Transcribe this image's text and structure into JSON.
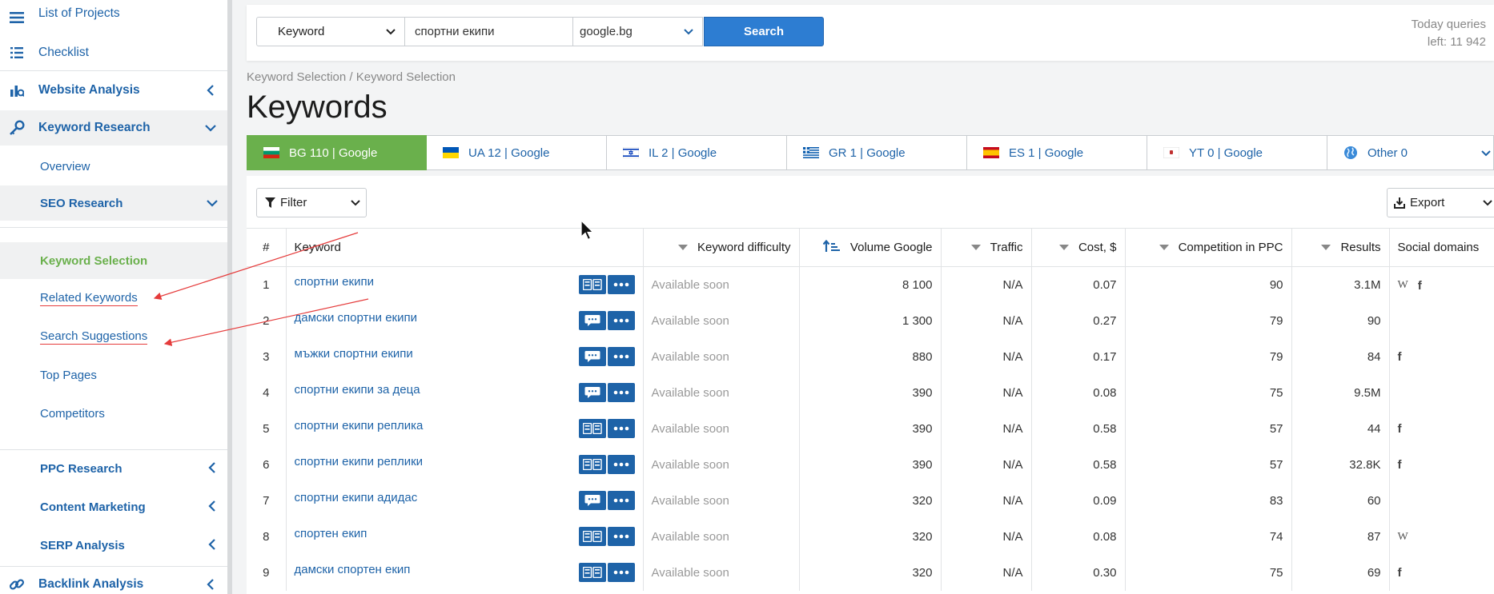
{
  "sidebar": {
    "list_of_projects": "List of Projects",
    "checklist": "Checklist",
    "website_analysis": "Website Analysis",
    "keyword_research": "Keyword Research",
    "overview": "Overview",
    "seo_research": "SEO Research",
    "keyword_selection": "Keyword Selection",
    "related_keywords": "Related Keywords",
    "search_suggestions": "Search Suggestions",
    "top_pages": "Top Pages",
    "competitors": "Competitors",
    "ppc_research": "PPC Research",
    "content_marketing": "Content Marketing",
    "serp_analysis": "SERP Analysis",
    "backlink_analysis": "Backlink Analysis"
  },
  "search": {
    "kind": "Keyword",
    "query": "спортни екипи",
    "engine": "google.bg",
    "button": "Search",
    "queries_line1": "Today queries",
    "queries_line2": "left: 11 942"
  },
  "breadcrumb": "Keyword Selection / Keyword Selection",
  "title": "Keywords",
  "tabs": [
    {
      "label": "BG 110 | Google",
      "flag": "bg"
    },
    {
      "label": "UA 12 | Google",
      "flag": "ua"
    },
    {
      "label": "IL 2 | Google",
      "flag": "il"
    },
    {
      "label": "GR 1 | Google",
      "flag": "gr"
    },
    {
      "label": "ES 1 | Google",
      "flag": "es"
    },
    {
      "label": "YT 0 | Google",
      "flag": "yt"
    },
    {
      "label": "Other 0",
      "flag": "globe"
    }
  ],
  "toolbar": {
    "filter": "Filter",
    "export": "Export"
  },
  "table": {
    "headers": {
      "num": "#",
      "keyword": "Keyword",
      "difficulty": "Keyword difficulty",
      "volume": "Volume Google",
      "traffic": "Traffic",
      "cost": "Cost, $",
      "competition": "Competition in PPC",
      "results": "Results",
      "social": "Social domains"
    },
    "rows": [
      {
        "n": "1",
        "kw": "спортни екипи",
        "icon": "serp",
        "diff": "Available soon",
        "vol": "8 100",
        "traffic": "N/A",
        "cost": "0.07",
        "comp": "90",
        "results": "3.1M",
        "social": [
          "W",
          "f"
        ]
      },
      {
        "n": "2",
        "kw": "дамски спортни екипи",
        "icon": "chat",
        "diff": "Available soon",
        "vol": "1 300",
        "traffic": "N/A",
        "cost": "0.27",
        "comp": "79",
        "results": "90",
        "social": []
      },
      {
        "n": "3",
        "kw": "мъжки спортни екипи",
        "icon": "chat",
        "diff": "Available soon",
        "vol": "880",
        "traffic": "N/A",
        "cost": "0.17",
        "comp": "79",
        "results": "84",
        "social": [
          "f"
        ]
      },
      {
        "n": "4",
        "kw": "спортни екипи за деца",
        "icon": "chat",
        "diff": "Available soon",
        "vol": "390",
        "traffic": "N/A",
        "cost": "0.08",
        "comp": "75",
        "results": "9.5M",
        "social": []
      },
      {
        "n": "5",
        "kw": "спортни екипи реплика",
        "icon": "serp",
        "diff": "Available soon",
        "vol": "390",
        "traffic": "N/A",
        "cost": "0.58",
        "comp": "57",
        "results": "44",
        "social": [
          "f"
        ]
      },
      {
        "n": "6",
        "kw": "спортни екипи реплики",
        "icon": "serp",
        "diff": "Available soon",
        "vol": "390",
        "traffic": "N/A",
        "cost": "0.58",
        "comp": "57",
        "results": "32.8K",
        "social": [
          "f"
        ]
      },
      {
        "n": "7",
        "kw": "спортни екипи адидас",
        "icon": "chat",
        "diff": "Available soon",
        "vol": "320",
        "traffic": "N/A",
        "cost": "0.09",
        "comp": "83",
        "results": "60",
        "social": []
      },
      {
        "n": "8",
        "kw": "спортен екип",
        "icon": "serp",
        "diff": "Available soon",
        "vol": "320",
        "traffic": "N/A",
        "cost": "0.08",
        "comp": "74",
        "results": "87",
        "social": [
          "W"
        ]
      },
      {
        "n": "9",
        "kw": "дамски спортен екип",
        "icon": "serp",
        "diff": "Available soon",
        "vol": "320",
        "traffic": "N/A",
        "cost": "0.30",
        "comp": "75",
        "results": "69",
        "social": [
          "f"
        ]
      }
    ]
  },
  "colors": {
    "link": "#1e63a8",
    "active_green": "#6ab04c",
    "button_blue": "#2d7dd2",
    "annotation_red": "#e53b3b"
  }
}
